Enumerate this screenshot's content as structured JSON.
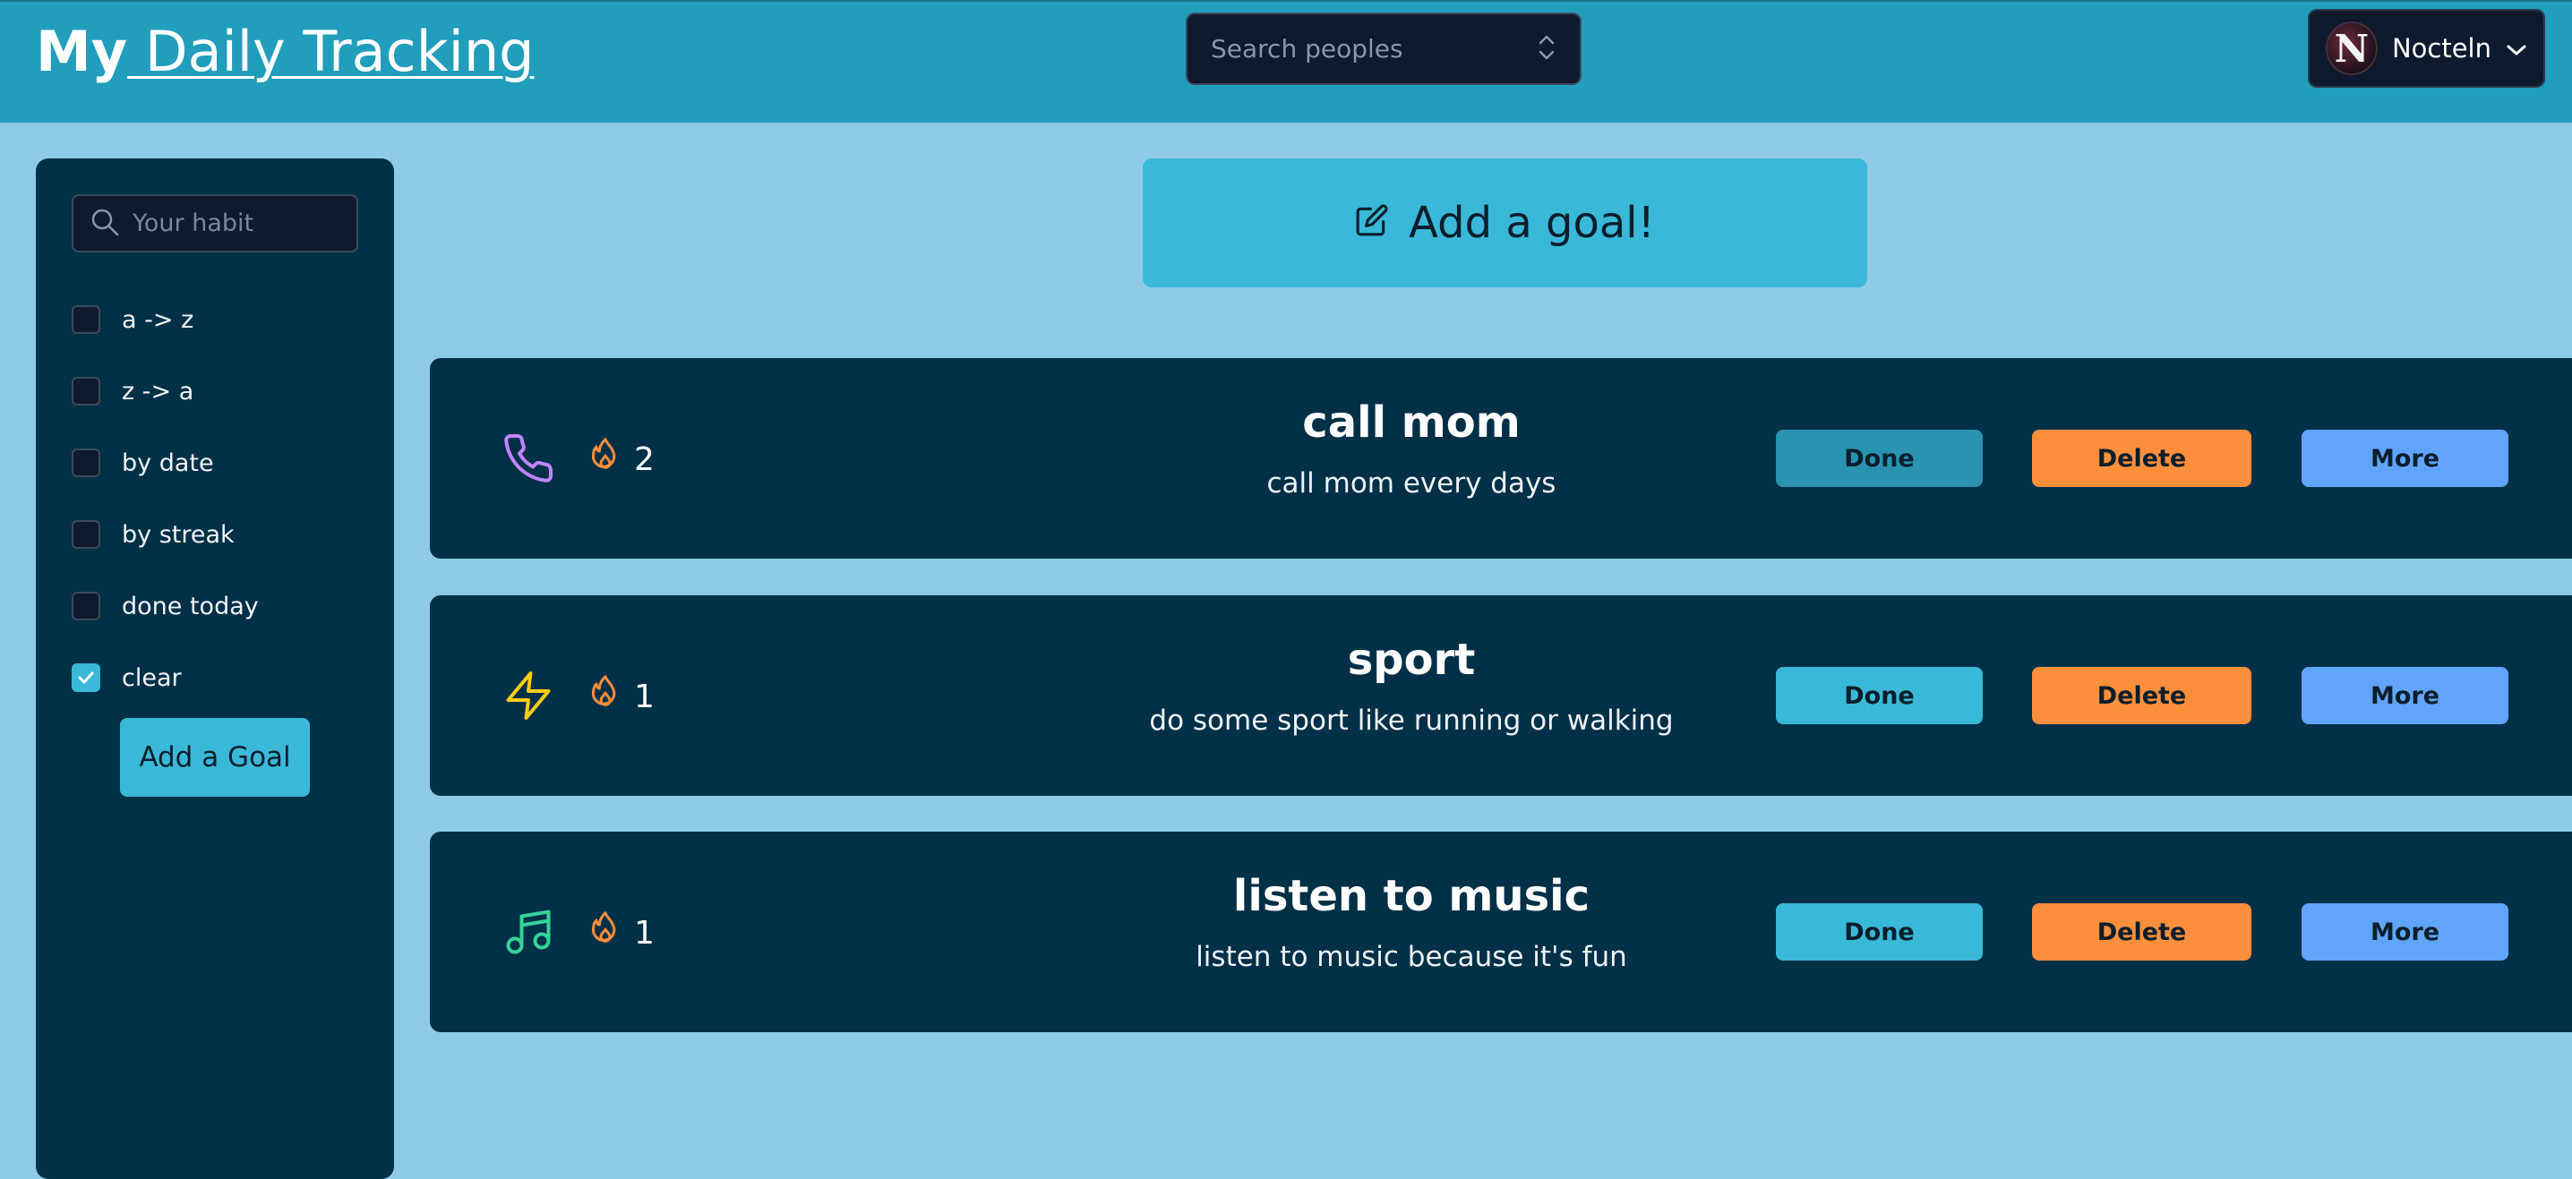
{
  "header": {
    "brand_bold": "My",
    "brand_rest": " Daily Tracking",
    "search_placeholder": "Search peoples",
    "user_name": "Nocteln",
    "avatar_letter": "N"
  },
  "sidebar": {
    "search_placeholder": "Your habit",
    "filters": [
      {
        "label": "a -> z",
        "checked": false
      },
      {
        "label": "z -> a",
        "checked": false
      },
      {
        "label": "by date",
        "checked": false
      },
      {
        "label": "by streak",
        "checked": false
      },
      {
        "label": "done today",
        "checked": false
      },
      {
        "label": "clear",
        "checked": true
      }
    ],
    "add_button_label": "Add a Goal"
  },
  "main": {
    "add_goal_label": "Add a goal!",
    "goals": [
      {
        "title": "call mom",
        "description": "call mom every days",
        "streak": "2",
        "icon": "phone-icon",
        "icon_color": "#c084fc",
        "done_today": true
      },
      {
        "title": "sport",
        "description": "do some sport like running or walking",
        "streak": "1",
        "icon": "lightning-icon",
        "icon_color": "#facc15",
        "done_today": false
      },
      {
        "title": "listen to music",
        "description": "listen to music because it's fun",
        "streak": "1",
        "icon": "music-note-icon",
        "icon_color": "#34d399",
        "done_today": false
      }
    ],
    "done_label": "Done",
    "delete_label": "Delete",
    "more_label": "More"
  },
  "colors": {
    "header_bg": "#219ebc",
    "page_bg": "#8ecae6",
    "panel_bg": "#023047",
    "accent": "#3ab8d8",
    "delete": "#fb8f3c",
    "more": "#60a5fa",
    "streak_flame": "#fb8f3c"
  }
}
